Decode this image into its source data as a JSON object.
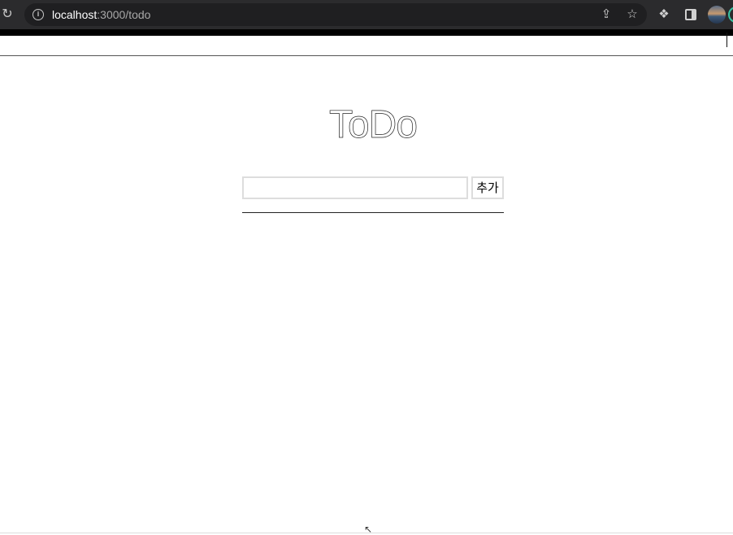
{
  "browser": {
    "url_host": "localhost",
    "url_path": ":3000/todo",
    "reload_icon": "reload-icon",
    "info_icon": "info-icon",
    "share_icon": "share-icon",
    "bookmark_icon": "star-icon",
    "extensions_icon": "puzzle-icon",
    "sidepanel_icon": "side-panel-icon",
    "profile_icon": "avatar"
  },
  "app": {
    "title": "ToDo",
    "input_value": "",
    "add_button_label": "추가"
  }
}
